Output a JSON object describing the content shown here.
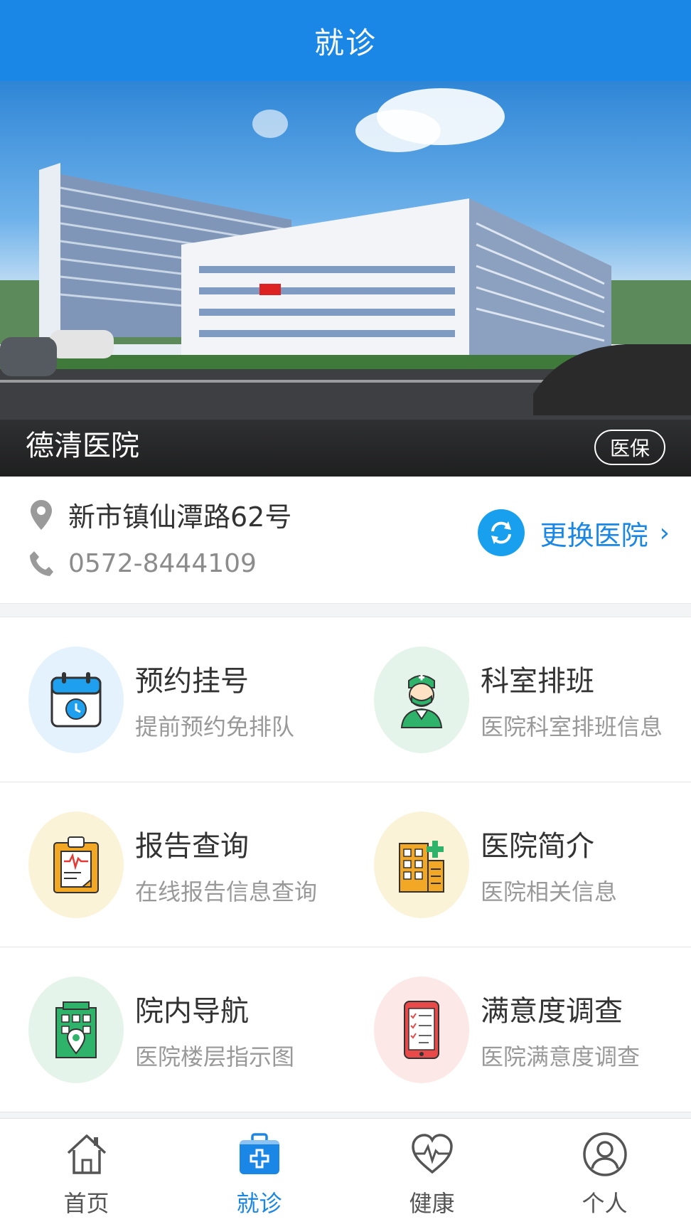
{
  "header": {
    "title": "就诊"
  },
  "banner": {
    "hospital_name": "德清医院",
    "badge": "医保"
  },
  "info": {
    "address": "新市镇仙潭路62号",
    "phone": "0572-8444109",
    "switch_label": "更换医院",
    "chevron": "›"
  },
  "services": [
    {
      "title": "预约挂号",
      "subtitle": "提前预约免排队",
      "icon": "calendar-clock-icon",
      "bg": "#e3f2fc"
    },
    {
      "title": "科室排班",
      "subtitle": "医院科室排班信息",
      "icon": "doctor-icon",
      "bg": "#e5f4ea"
    },
    {
      "title": "报告查询",
      "subtitle": "在线报告信息查询",
      "icon": "clipboard-report-icon",
      "bg": "#fbf3d8"
    },
    {
      "title": "医院简介",
      "subtitle": "医院相关信息",
      "icon": "hospital-building-icon",
      "bg": "#fbf3d8"
    },
    {
      "title": "院内导航",
      "subtitle": "医院楼层指示图",
      "icon": "building-location-icon",
      "bg": "#e5f4ea"
    },
    {
      "title": "满意度调查",
      "subtitle": "医院满意度调查",
      "icon": "phone-survey-icon",
      "bg": "#fde8e8"
    }
  ],
  "tabs": [
    {
      "label": "首页",
      "icon": "home-icon"
    },
    {
      "label": "就诊",
      "icon": "medical-kit-icon",
      "active": true
    },
    {
      "label": "健康",
      "icon": "heart-pulse-icon"
    },
    {
      "label": "个人",
      "icon": "user-icon"
    }
  ],
  "colors": {
    "primary": "#1a87e6",
    "switch_circle": "#18a0ee"
  }
}
